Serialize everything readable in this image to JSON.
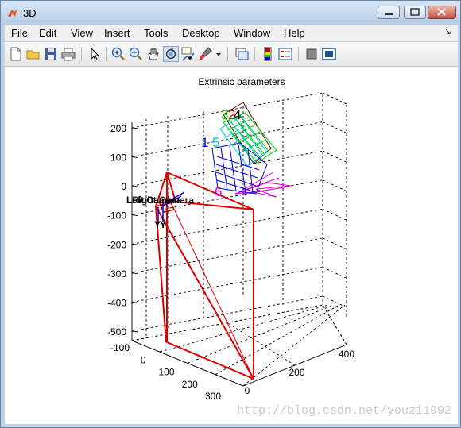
{
  "window": {
    "title": "3D"
  },
  "menu": [
    "File",
    "Edit",
    "View",
    "Insert",
    "Tools",
    "Desktop",
    "Window",
    "Help"
  ],
  "toolbar_icons": [
    "new-figure-icon",
    "open-file-icon",
    "save-icon",
    "print-icon",
    "edit-plot-icon",
    "zoom-in-icon",
    "zoom-out-icon",
    "pan-icon",
    "rotate-3d-icon",
    "data-cursor-icon",
    "brush-icon",
    "brush-dropdown-icon",
    "link-plot-icon",
    "insert-colorbar-icon",
    "insert-legend-icon",
    "hide-plot-tools-icon",
    "show-plot-tools-icon"
  ],
  "colors": {
    "camera": "#dd0000",
    "grid": "#000000",
    "frame1": "#0000dd",
    "frame2": "#00cccc",
    "frame3": "#00cc00",
    "frame4": "#660000",
    "frame5": "#00cccc",
    "frame6": "#dd00dd"
  },
  "chart_data": {
    "type": "3d-line",
    "title": "Extrinsic parameters",
    "z_ticks": [
      "200",
      "100",
      "0",
      "-100",
      "-200",
      "-300",
      "-400",
      "-500"
    ],
    "x_ticks": [
      "-100",
      "0",
      "100",
      "200",
      "300"
    ],
    "y_ticks": [
      "0",
      "200",
      "400"
    ],
    "grid": true,
    "frame_labels": [
      "3",
      "2",
      "4",
      "1",
      "5",
      "6"
    ],
    "camera_labels": [
      "Left Camera",
      "Right Camera",
      "Y",
      "Y"
    ]
  },
  "watermark": "http://blog.csdn.net/youzi1992"
}
